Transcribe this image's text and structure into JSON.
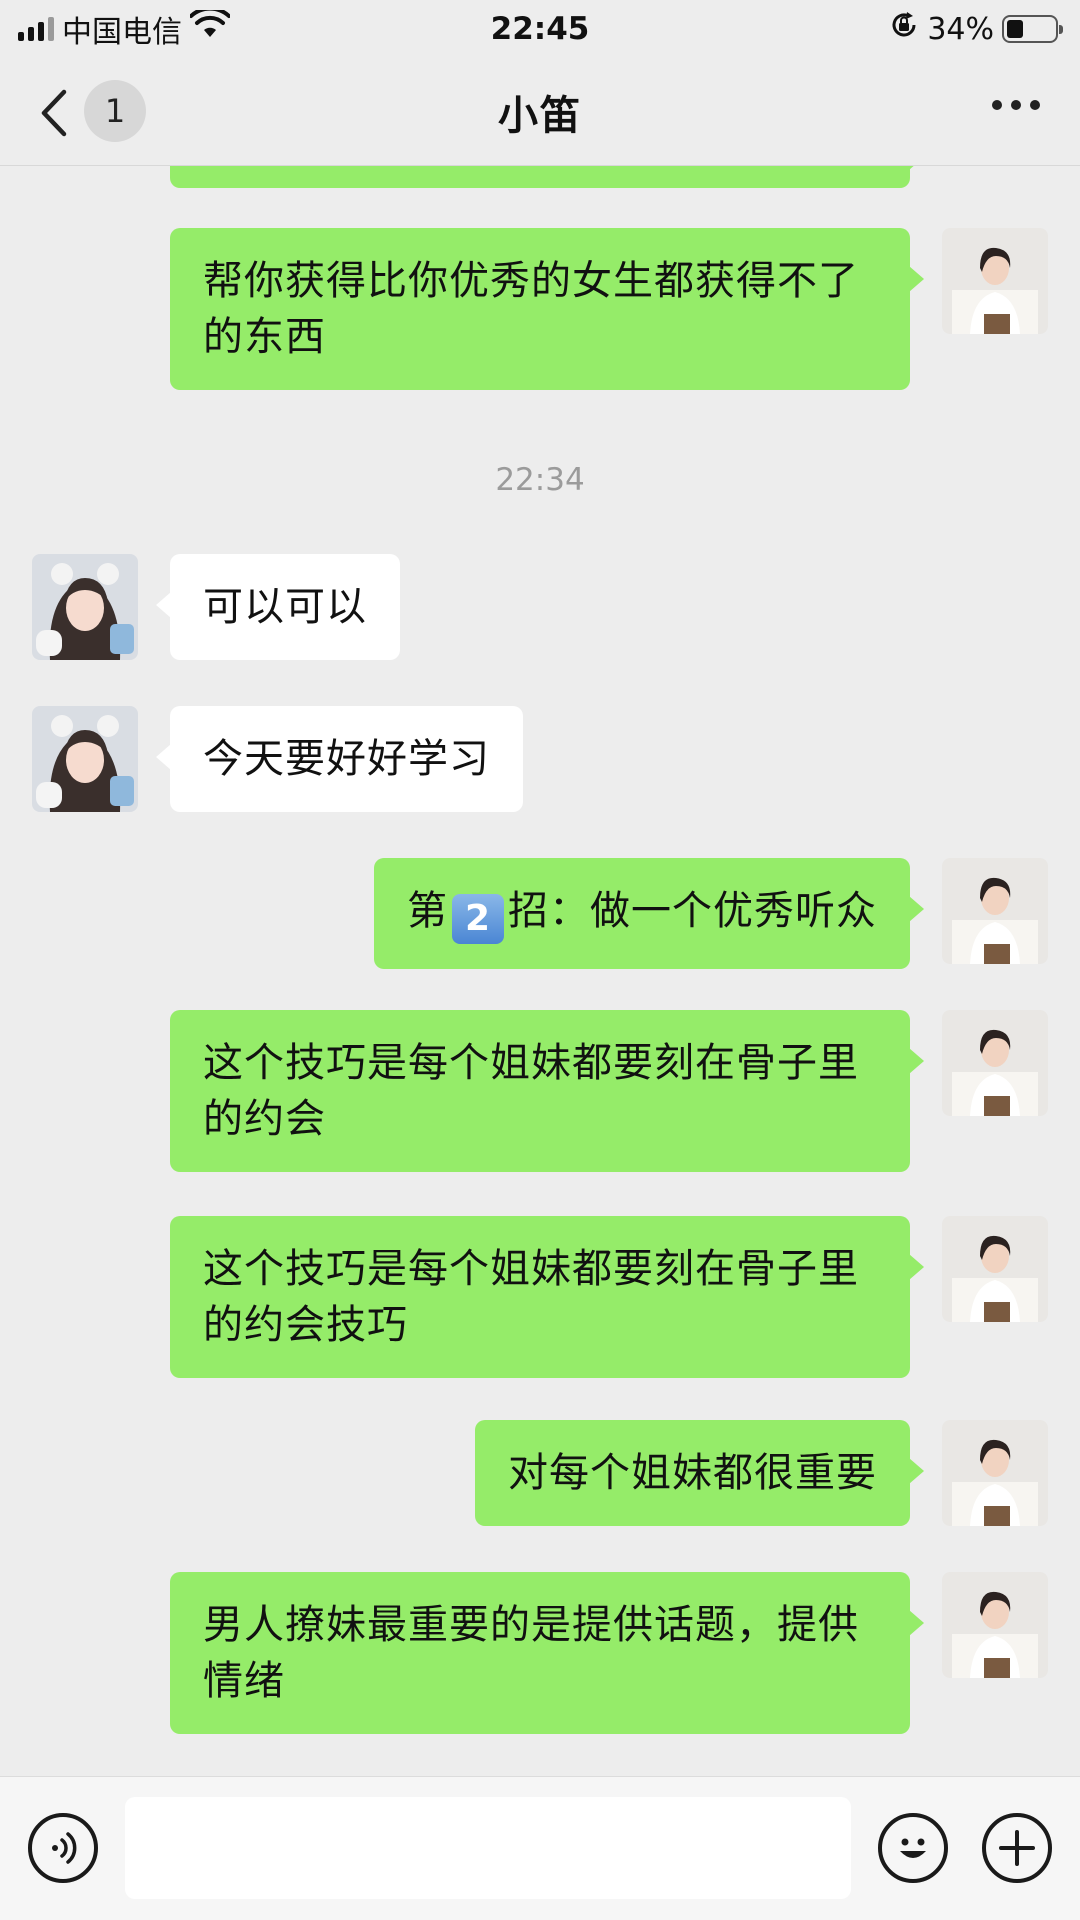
{
  "status_bar": {
    "carrier": "中国电信",
    "time": "22:45",
    "battery_percent": "34%",
    "battery_level": 0.34,
    "icons": [
      "signal-icon",
      "wifi-icon",
      "rotation-lock-icon",
      "battery-icon"
    ]
  },
  "nav": {
    "back_icon": "chevron-left-icon",
    "unread_badge": "1",
    "title": "小笛",
    "more_icon": "more-dots-icon"
  },
  "messages": [
    {
      "side": "out",
      "text": "帮你获得比你优秀的女生都获得不了的东西"
    },
    {
      "type": "time",
      "text": "22:34"
    },
    {
      "side": "in",
      "text": "可以可以"
    },
    {
      "side": "in",
      "text": "今天要好好学习"
    },
    {
      "side": "out",
      "text_before": "第",
      "emoji": "2",
      "text_after": "招：做一个优秀听众"
    },
    {
      "side": "out",
      "text": "这个技巧是每个姐妹都要刻在骨子里的约会"
    },
    {
      "side": "out",
      "text": "这个技巧是每个姐妹都要刻在骨子里的约会技巧"
    },
    {
      "side": "out",
      "text": "对每个姐妹都很重要"
    },
    {
      "side": "out",
      "text": "男人撩妹最重要的是提供话题，提供情绪"
    }
  ],
  "input_bar": {
    "voice_icon": "voice-icon",
    "message_input_value": "",
    "emoji_icon": "emoji-icon",
    "plus_icon": "plus-icon"
  },
  "colors": {
    "background": "#ededed",
    "outgoing_bubble": "#95ec69",
    "incoming_bubble": "#ffffff",
    "timestamp": "#9b9b9b"
  }
}
